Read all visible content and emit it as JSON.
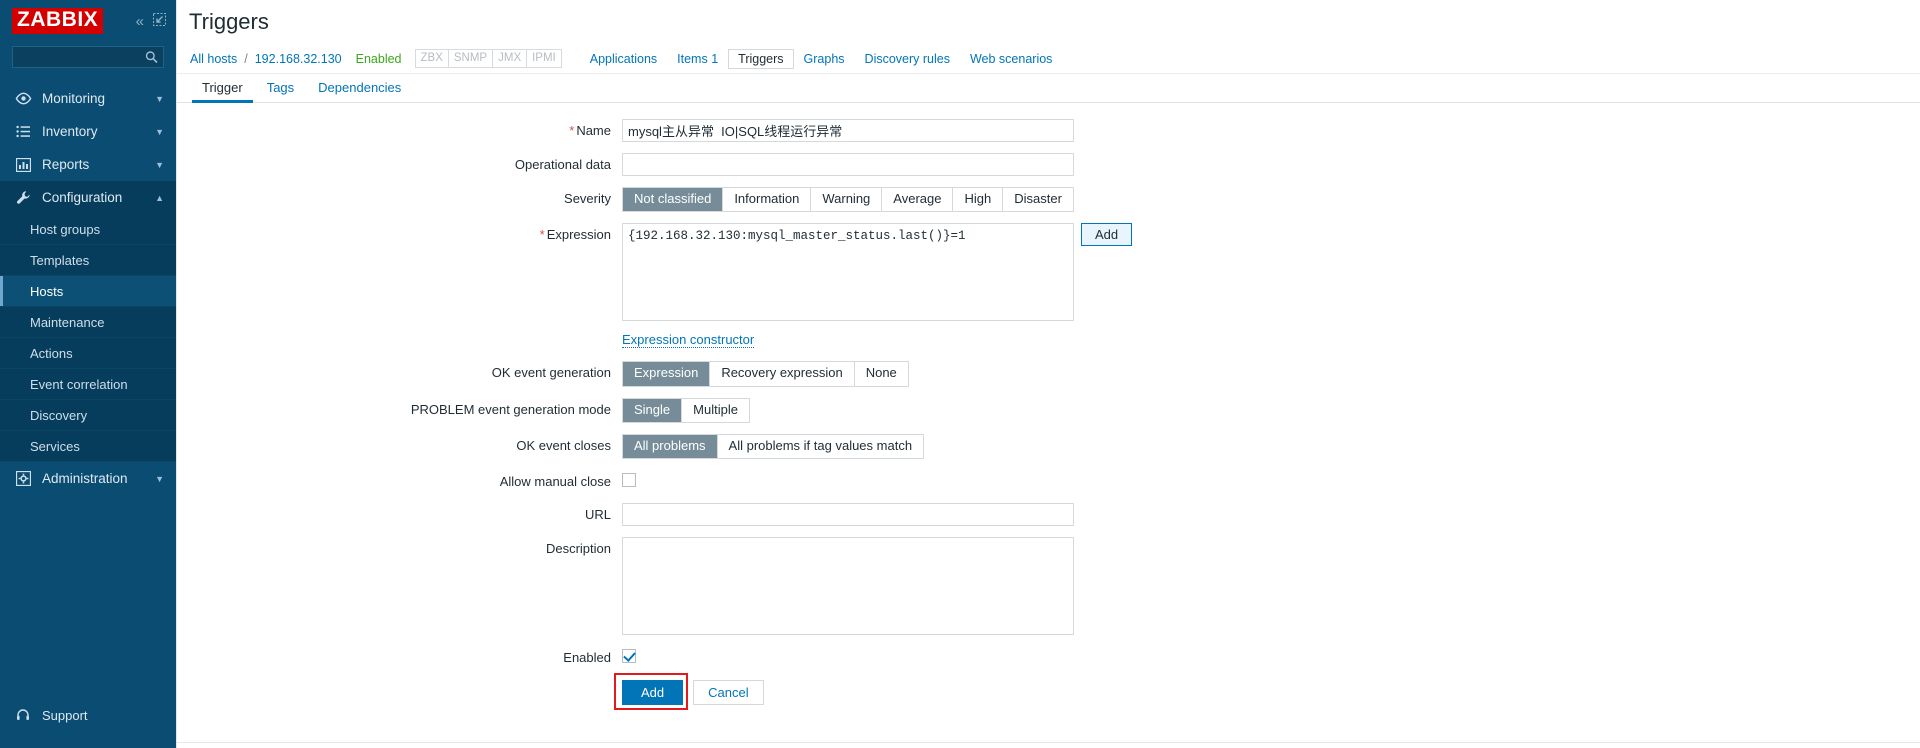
{
  "sidebar": {
    "logo": "ZABBIX",
    "collapse_icon": "chevrons-left-icon",
    "compact_icon": "compact-view-icon",
    "search": {
      "value": "",
      "placeholder": "",
      "icon": "search-icon"
    },
    "menu": [
      {
        "label": "Monitoring",
        "icon": "eye-icon",
        "chevron": "chevron-down-icon"
      },
      {
        "label": "Inventory",
        "icon": "list-icon",
        "chevron": "chevron-down-icon"
      },
      {
        "label": "Reports",
        "icon": "bar-chart-icon",
        "chevron": "chevron-down-icon"
      },
      {
        "label": "Configuration",
        "icon": "wrench-icon",
        "chevron": "chevron-up-icon"
      }
    ],
    "submenu": [
      {
        "label": "Host groups"
      },
      {
        "label": "Templates"
      },
      {
        "label": "Hosts"
      },
      {
        "label": "Maintenance"
      },
      {
        "label": "Actions"
      },
      {
        "label": "Event correlation"
      },
      {
        "label": "Discovery"
      },
      {
        "label": "Services"
      }
    ],
    "submenu_selected": "Hosts",
    "administration": {
      "label": "Administration",
      "icon": "gear-icon",
      "chevron": "chevron-down-icon"
    },
    "support": {
      "label": "Support",
      "icon": "headset-icon"
    }
  },
  "header": {
    "title": "Triggers"
  },
  "breadcrumb": {
    "all_hosts": "All hosts",
    "separator": "/",
    "host": "192.168.32.130",
    "status": "Enabled",
    "protocols": [
      "ZBX",
      "SNMP",
      "JMX",
      "IPMI"
    ],
    "nav": [
      {
        "label": "Applications",
        "selected": false
      },
      {
        "label": "Items 1",
        "selected": false
      },
      {
        "label": "Triggers",
        "selected": true
      },
      {
        "label": "Graphs",
        "selected": false
      },
      {
        "label": "Discovery rules",
        "selected": false
      },
      {
        "label": "Web scenarios",
        "selected": false
      }
    ]
  },
  "tabs": [
    {
      "label": "Trigger",
      "selected": true
    },
    {
      "label": "Tags",
      "selected": false
    },
    {
      "label": "Dependencies",
      "selected": false
    }
  ],
  "form": {
    "name": {
      "label": "Name",
      "required": true,
      "value": "mysql主从异常  IO|SQL线程运行异常",
      "placeholder": ""
    },
    "operational_data": {
      "label": "Operational data",
      "required": false,
      "value": "",
      "placeholder": ""
    },
    "severity": {
      "label": "Severity",
      "options": [
        "Not classified",
        "Information",
        "Warning",
        "Average",
        "High",
        "Disaster"
      ],
      "selected": "Not classified"
    },
    "expression": {
      "label": "Expression",
      "required": true,
      "value": "{192.168.32.130:mysql_master_status.last()}=1",
      "add_button": "Add",
      "constructor_link": "Expression constructor"
    },
    "ok_event_generation": {
      "label": "OK event generation",
      "options": [
        "Expression",
        "Recovery expression",
        "None"
      ],
      "selected": "Expression"
    },
    "problem_event_generation_mode": {
      "label": "PROBLEM event generation mode",
      "options": [
        "Single",
        "Multiple"
      ],
      "selected": "Single"
    },
    "ok_event_closes": {
      "label": "OK event closes",
      "options": [
        "All problems",
        "All problems if tag values match"
      ],
      "selected": "All problems"
    },
    "allow_manual_close": {
      "label": "Allow manual close",
      "checked": false
    },
    "url": {
      "label": "URL",
      "value": "",
      "placeholder": ""
    },
    "description": {
      "label": "Description",
      "value": "",
      "placeholder": ""
    },
    "enabled": {
      "label": "Enabled",
      "checked": true
    },
    "submit": {
      "add_label": "Add",
      "cancel_label": "Cancel"
    }
  },
  "colors": {
    "sidebar_bg": "#0a4c72",
    "sidebar_active": "#073d5c",
    "brand_red": "#d40000",
    "link_blue": "#0275b8",
    "segment_selected": "#768d99",
    "enabled_green": "#3aa81b",
    "annotation_red": "#e01b1b"
  }
}
